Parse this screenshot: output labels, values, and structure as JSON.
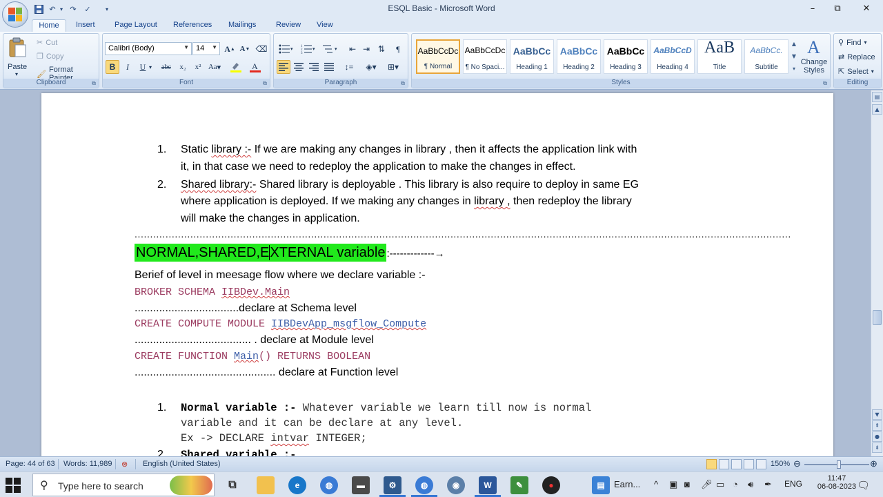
{
  "window": {
    "title": "ESQL Basic - Microsoft Word",
    "minimize": "–",
    "restore": "⧉",
    "close": "✕"
  },
  "tabs": [
    "Home",
    "Insert",
    "Page Layout",
    "References",
    "Mailings",
    "Review",
    "View"
  ],
  "ribbon": {
    "clipboard": {
      "label": "Clipboard",
      "paste": "Paste",
      "cut": "Cut",
      "copy": "Copy",
      "format_painter": "Format Painter"
    },
    "font": {
      "label": "Font",
      "font_name": "Calibri (Body)",
      "font_size": "14",
      "bold": "B",
      "italic": "I",
      "underline": "U",
      "strike": "abc",
      "subscript": "x₂",
      "superscript": "x²",
      "change_case": "Aa",
      "grow": "A",
      "shrink": "A"
    },
    "paragraph": {
      "label": "Paragraph"
    },
    "styles": {
      "label": "Styles",
      "items": [
        {
          "sample": "AaBbCcDc",
          "name": "¶ Normal"
        },
        {
          "sample": "AaBbCcDc",
          "name": "¶ No Spaci..."
        },
        {
          "sample": "AaBbCc",
          "name": "Heading 1"
        },
        {
          "sample": "AaBbCc",
          "name": "Heading 2"
        },
        {
          "sample": "AaBbCc",
          "name": "Heading 3"
        },
        {
          "sample": "AaBbCcD",
          "name": "Heading 4"
        },
        {
          "sample": "AaB",
          "name": "Title"
        },
        {
          "sample": "AaBbCc.",
          "name": "Subtitle"
        }
      ],
      "change_styles": "Change Styles"
    },
    "editing": {
      "label": "Editing",
      "find": "Find",
      "replace": "Replace",
      "select": "Select"
    }
  },
  "doc": {
    "list1": [
      {
        "num": "1.",
        "line1_a": "Static ",
        "line1_b": "library :-",
        "line1_c": " If we are making any changes in library , then it affects the application link with",
        "line2": "it, in that case we need to redeploy the application to make the changes in effect."
      },
      {
        "num": "2.",
        "line1_a": "Shared library:-",
        "line1_b": " Shared library is deployable . This library is also require to deploy in same EG",
        "line2_a": "where application is deployed. If we making any changes in ",
        "line2_b": "library ,",
        "line2_c": " then redeploy the library",
        "line3": "will make the changes in application."
      }
    ],
    "dotted_line": "....................................................................................................................................................................................................................",
    "heading_a": "NORMAL,SHARED,E",
    "heading_b": "XTERNAL variable",
    "heading_arrow": ":-------------→",
    "brief": "Berief of level  in meesage flow where we declare variable :-",
    "code1_a": "BROKER SCHEMA ",
    "code1_b": "IIBDev.Main",
    "dots1": "..................................declare at Schema level",
    "code2_a": "CREATE COMPUTE MODULE ",
    "code2_b": "IIBDevApp_msgflow_Compute",
    "dots2": "...................................... . declare at Module level",
    "code3_a": "CREATE FUNCTION ",
    "code3_b": "Main",
    "code3_c": "() RETURNS BOOLEAN",
    "dots3": ".............................................. declare at Function level",
    "list2": [
      {
        "num": "1.",
        "title": "Normal variable :-",
        "rest": " Whatever variable we learn till now is normal",
        "line2": "variable and it can be declare at any level.",
        "line3_a": "Ex -> DECLARE ",
        "line3_b": "intvar",
        "line3_c": " INTEGER;"
      },
      {
        "num": "2.",
        "title": "Shared variable :-"
      }
    ]
  },
  "status": {
    "page": "Page: 44 of 63",
    "words": "Words: 11,989",
    "language": "English (United States)",
    "zoom": "150%"
  },
  "taskbar": {
    "search_placeholder": "Type here to search",
    "app_label": "Earn...",
    "lang": "ENG",
    "time": "11:47",
    "date": "06-08-2023"
  }
}
